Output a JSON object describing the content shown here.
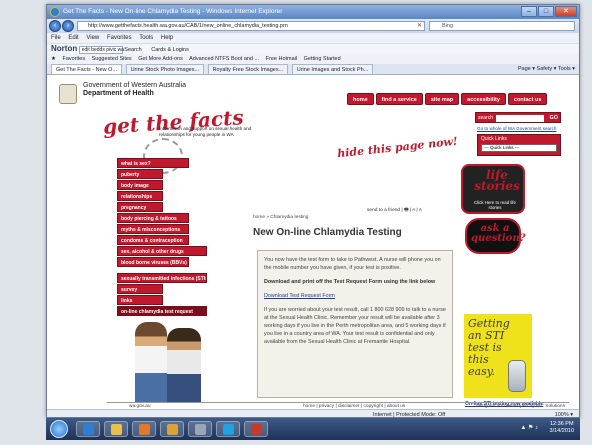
{
  "window": {
    "title": "Get The Facts - New On-line Chlamydia Testing - Windows Internet Explorer",
    "url": "http://www.getthefacts.health.wa.gov.au/CAB/1/new_online_chlamydia_testing.prn",
    "search_placeholder": "Bing"
  },
  "menu": [
    "File",
    "Edit",
    "View",
    "Favorites",
    "Tools",
    "Help"
  ],
  "toolbar": {
    "brand": "Norton",
    "field_value": "edit bedds pivic wa",
    "search_label": "Search",
    "extra": "Cards & Logins"
  },
  "favorites": {
    "label": "Favorites",
    "items": [
      "Suggested Sites",
      "Get More Add-ons",
      "Advanced NTFS Boot and ...",
      "Free Hotmail",
      "Getting Started"
    ]
  },
  "tabs": {
    "items": [
      "Get The Facts - New O...",
      "Urine Stock Photo Images...",
      "Royalty Free Stock Images...",
      "Urine Images and Stock Ph..."
    ],
    "right": "Page ▾  Safety ▾  Tools ▾"
  },
  "site": {
    "gov_line1": "Government of Western Australia",
    "gov_line2": "Department of Health",
    "logo": "get the facts",
    "tagline": "Information and support on sexual health and relationships for young people in WA",
    "hide": "hide this page now!",
    "topnav": [
      "home",
      "find a service",
      "site map",
      "accessibility",
      "contact us"
    ],
    "search_label": "search",
    "search_go": "GO",
    "whole_wa": "Go to whole of WA Government search",
    "quick_links_title": "Quick Links",
    "quick_links_select": "--- Quick Links ---"
  },
  "leftnav": [
    "what is sex?",
    "puberty",
    "body image",
    "relationships",
    "pregnancy",
    "body piercing & tattoos",
    "myths & misconceptions",
    "condoms & contraception",
    "sex, alcohol & other drugs",
    "blood borne viruses (BBVs)",
    "sexually transmitted infections (STIs)",
    "survey",
    "links",
    "on-line chlamydia test request"
  ],
  "page": {
    "breadcrumb": "home » Chlamydia testing",
    "send_friend": "send to a friend |  🖶 |  A  |  A",
    "title": "New On-line Chlamydia Testing",
    "p1": "You now have the test form to take to Pathwest. A nurse will phone you on the mobile number you have given, if your test is positive.",
    "p2": "Download and print off the Test Request Form using the link below",
    "p3": "Download Test Request Form",
    "p4": "If you are worried about your test result, call 1 800 628 909 to talk to a nurse at the Sexual Health Clinic. Remember your result will be available after 3 working days if you live in the Perth metropolitan area, and 5 working days if you live in a country area of WA. Your test result is confidential and only available from the Sexual Health Clinic at Fremantle Hospital."
  },
  "right": {
    "life_title": "life stories",
    "life_caption": "Click Here to read life stories",
    "ask_title": "ask a question?",
    "sti_text": "Getting an STI test is this easy.",
    "sti_link": "On-line STI testing now available"
  },
  "footer": {
    "wa": "wa.gov.au",
    "links": "home  |  privacy  |  disclaimer  |  copyright  |  about us",
    "design": "designed and developed by IBC Solutions"
  },
  "status": {
    "zone": "Internet | Protected Mode: Off",
    "zoom": "100% ▾"
  },
  "clock": {
    "time": "12:36 PM",
    "date": "3/14/2010"
  }
}
